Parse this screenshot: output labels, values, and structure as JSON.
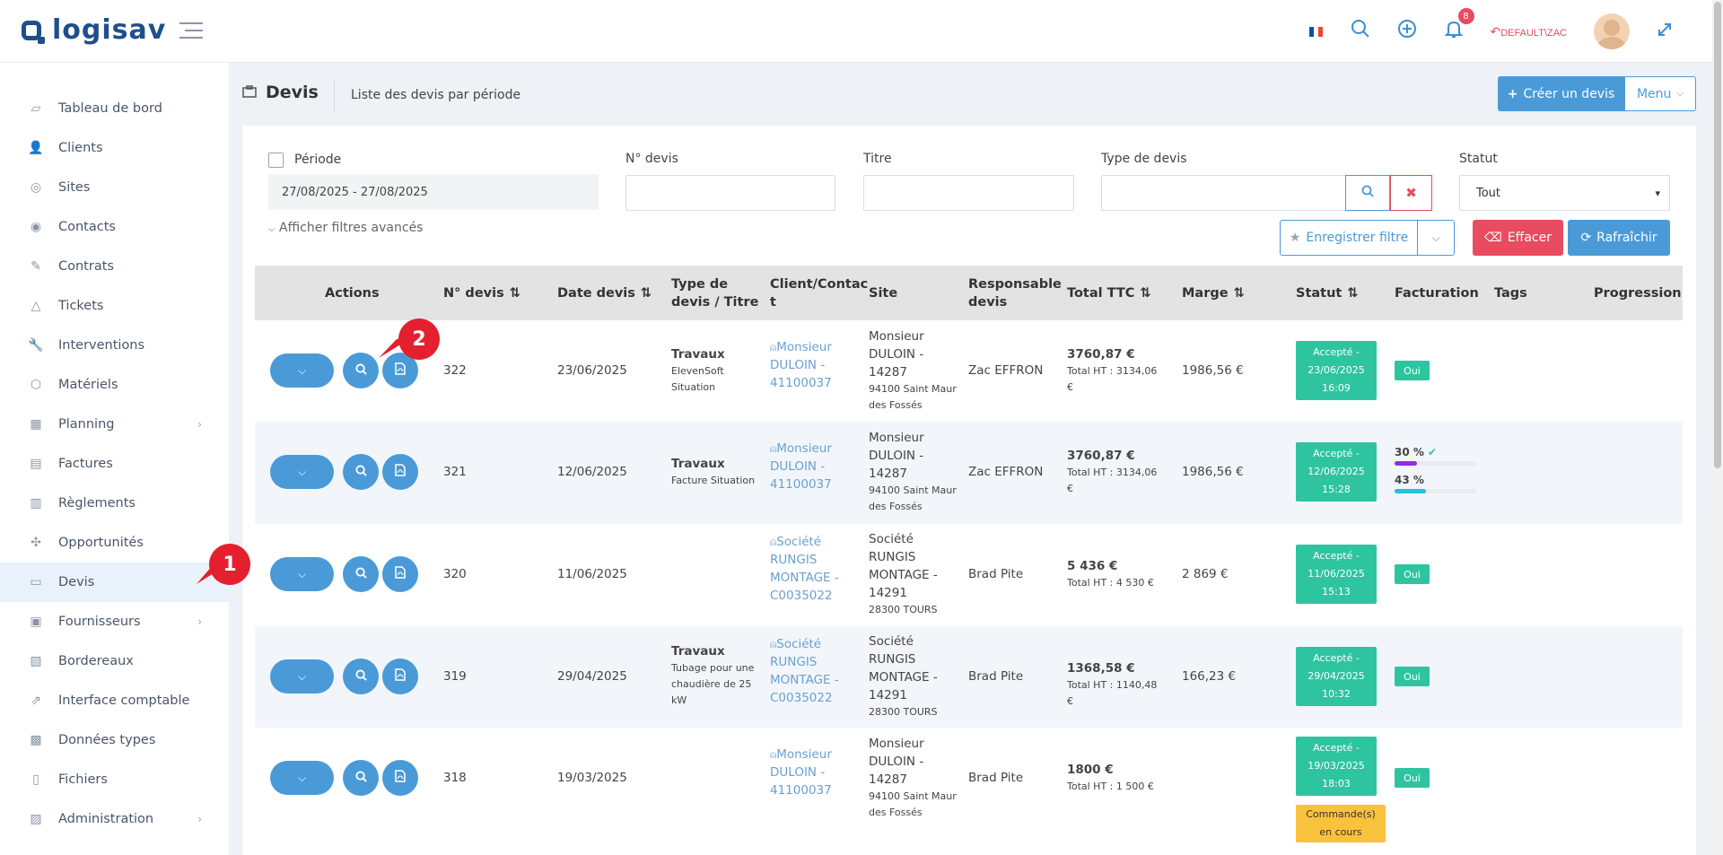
{
  "app": {
    "logo_text": "logisav"
  },
  "header": {
    "flag_colors": [
      "#0055a4",
      "#ffffff",
      "#ef4135"
    ],
    "notification_count": "8",
    "user_label": "DEFAULT\\ZAC"
  },
  "sidebar": {
    "items": [
      {
        "label": "Tableau de bord",
        "icon": "dashboard-icon"
      },
      {
        "label": "Clients",
        "icon": "clients-icon"
      },
      {
        "label": "Sites",
        "icon": "sites-icon"
      },
      {
        "label": "Contacts",
        "icon": "contacts-icon"
      },
      {
        "label": "Contrats",
        "icon": "contracts-icon"
      },
      {
        "label": "Tickets",
        "icon": "tickets-icon"
      },
      {
        "label": "Interventions",
        "icon": "wrench-icon"
      },
      {
        "label": "Matériels",
        "icon": "box-icon"
      },
      {
        "label": "Planning",
        "icon": "calendar-icon"
      },
      {
        "label": "Factures",
        "icon": "invoice-icon"
      },
      {
        "label": "Règlements",
        "icon": "payments-icon"
      },
      {
        "label": "Opportunités",
        "icon": "opportunities-icon"
      },
      {
        "label": "Devis",
        "icon": "briefcase-icon"
      },
      {
        "label": "Fournisseurs",
        "icon": "suppliers-icon"
      },
      {
        "label": "Bordereaux",
        "icon": "slips-icon"
      },
      {
        "label": "Interface comptable",
        "icon": "external-link-icon"
      },
      {
        "label": "Données types",
        "icon": "data-types-icon"
      },
      {
        "label": "Fichiers",
        "icon": "files-icon"
      },
      {
        "label": "Administration",
        "icon": "admin-icon"
      }
    ]
  },
  "page": {
    "title": "Devis",
    "subtitle": "Liste des devis par période",
    "create_button": "Créer un devis",
    "menu_button": "Menu"
  },
  "filters": {
    "period_label": "Période",
    "period_value": "27/08/2025 - 27/08/2025",
    "number_label": "N° devis",
    "title_label": "Titre",
    "type_label": "Type de devis",
    "status_label": "Statut",
    "status_value": "Tout",
    "advanced_label": "Afficher filtres avancés",
    "save_button": "Enregistrer filtre",
    "erase_button": "Effacer",
    "refresh_button": "Rafraîchir"
  },
  "table": {
    "headers": {
      "actions": "Actions",
      "number": "N° devis",
      "date": "Date devis",
      "type": "Type de devis / Titre",
      "client": "Client/Contac t",
      "site": "Site",
      "manager": "Responsable devis",
      "total": "Total TTC",
      "margin": "Marge",
      "status": "Statut",
      "billing": "Facturation",
      "tags": "Tags",
      "progress": "Progression"
    },
    "rows": [
      {
        "number": "322",
        "date": "23/06/2025",
        "type": "Travaux",
        "title": [
          "ElevenSoft",
          "Situation"
        ],
        "client": [
          "Monsieur",
          "DULOIN -",
          "41100037"
        ],
        "site": [
          "Monsieur",
          "DULOIN -",
          "14287"
        ],
        "site_city": [
          "94100 Saint Maur",
          "des Fossés"
        ],
        "manager": "Zac EFFRON",
        "total": "3760,87 €",
        "total_ht": [
          "Total HT : 3134,06",
          "€"
        ],
        "margin": "1986,56 €",
        "status": [
          "Accepté -",
          "23/06/2025",
          "16:09"
        ],
        "billing": "Oui"
      },
      {
        "number": "321",
        "date": "12/06/2025",
        "type": "Travaux",
        "title": [
          "Facture Situation"
        ],
        "client": [
          "Monsieur",
          "DULOIN -",
          "41100037"
        ],
        "site": [
          "Monsieur",
          "DULOIN -",
          "14287"
        ],
        "site_city": [
          "94100 Saint Maur",
          "des Fossés"
        ],
        "manager": "Zac EFFRON",
        "total": "3760,87 €",
        "total_ht": [
          "Total HT : 3134,06",
          "€"
        ],
        "margin": "1986,56 €",
        "status": [
          "Accepté -",
          "12/06/2025",
          "15:28"
        ],
        "billing_progress": [
          {
            "label": "30 %",
            "value": 30,
            "color": "#8e2de2"
          },
          {
            "label": "43 %",
            "value": 43,
            "color": "#22c1d6"
          }
        ]
      },
      {
        "number": "320",
        "date": "11/06/2025",
        "type": "",
        "title": [],
        "client": [
          "Société",
          "RUNGIS",
          "MONTAGE -",
          "C0035022"
        ],
        "site": [
          "Société",
          "RUNGIS",
          "MONTAGE -",
          "14291"
        ],
        "site_city": [
          "28300 TOURS"
        ],
        "manager": "Brad Pite",
        "total": "5 436 €",
        "total_ht": [
          "Total HT : 4 530 €"
        ],
        "margin": "2 869 €",
        "status": [
          "Accepté -",
          "11/06/2025",
          "15:13"
        ],
        "billing": "Oui"
      },
      {
        "number": "319",
        "date": "29/04/2025",
        "type": "Travaux",
        "title": [
          "Tubage pour une",
          "chaudière de 25",
          "kW"
        ],
        "client": [
          "Société",
          "RUNGIS",
          "MONTAGE -",
          "C0035022"
        ],
        "site": [
          "Société",
          "RUNGIS",
          "MONTAGE -",
          "14291"
        ],
        "site_city": [
          "28300 TOURS"
        ],
        "manager": "Brad Pite",
        "total": "1368,58 €",
        "total_ht": [
          "Total HT : 1140,48 €"
        ],
        "margin": "166,23 €",
        "status": [
          "Accepté -",
          "29/04/2025",
          "10:32"
        ],
        "billing": "Oui"
      },
      {
        "number": "318",
        "date": "19/03/2025",
        "type": "",
        "title": [],
        "client": [
          "Monsieur",
          "DULOIN -",
          "41100037"
        ],
        "site": [
          "Monsieur",
          "DULOIN -",
          "14287"
        ],
        "site_city": [
          "94100 Saint Maur",
          "des Fossés"
        ],
        "manager": "Brad Pite",
        "total": "1800 €",
        "total_ht": [
          "Total HT : 1 500 €"
        ],
        "margin": "",
        "status": [
          "Accepté -",
          "19/03/2025",
          "18:03"
        ],
        "status_extra": [
          "Commande(s)",
          "en cours"
        ],
        "billing": "Oui"
      }
    ]
  },
  "callouts": [
    "1",
    "2"
  ]
}
